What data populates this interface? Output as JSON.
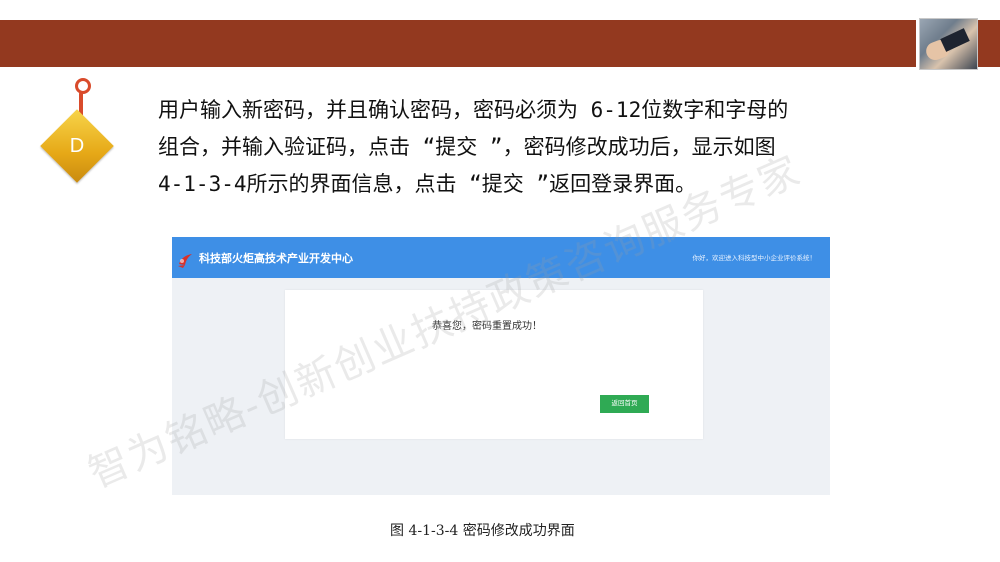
{
  "slide": {
    "badge_letter": "D",
    "paragraph_lines": [
      "用户输入新密码，并且确认密码，密码必须为 6-12位数字和字母的",
      "组合，并输入验证码，点击 “提交 ”，密码修改成功后，显示如图",
      "4-1-3-4所示的界面信息，点击 “提交 ”返回登录界面。"
    ],
    "caption": "图 4-1-3-4 密码修改成功界面",
    "watermark": "智为铭略-创新创业扶持政策咨询服务专家"
  },
  "screenshot": {
    "header_title": "科技部火炬高技术产业开发中心",
    "welcome_text": "你好，欢迎进入科技型中小企业评价系统！",
    "success_message": "恭喜您，密码重置成功！",
    "return_button": "返回首页"
  },
  "colors": {
    "band": "#93391f",
    "header_blue": "#3e8fe6",
    "button_green": "#2faa54",
    "badge_gold": "#e6a817"
  },
  "icons": [
    "slide-photo-icon",
    "badge-pin-icon",
    "torch-logo-icon"
  ]
}
